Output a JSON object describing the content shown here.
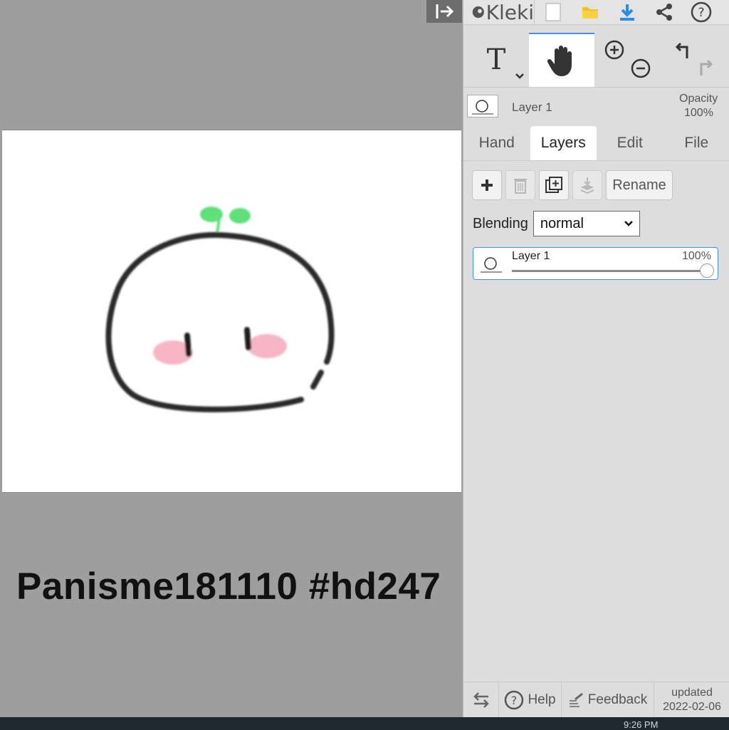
{
  "app": {
    "name": "Kleki"
  },
  "canvas": {
    "caption": "Panisme181110 #hd247"
  },
  "layer_info": {
    "name": "Layer 1",
    "opacity_label": "Opacity",
    "opacity_value": "100%"
  },
  "tabs": [
    {
      "label": "Hand",
      "active": false
    },
    {
      "label": "Layers",
      "active": true
    },
    {
      "label": "Edit",
      "active": false
    },
    {
      "label": "File",
      "active": false
    }
  ],
  "layers_panel": {
    "rename_label": "Rename",
    "blending_label": "Blending",
    "blending_value": "normal",
    "layers": [
      {
        "name": "Layer 1",
        "opacity": "100%",
        "opacity_level": 1.0
      }
    ]
  },
  "footer": {
    "help_label": "Help",
    "feedback_label": "Feedback",
    "updated_label": "updated",
    "updated_date": "2022-02-06"
  },
  "taskbar": {
    "clock": "9:26 PM"
  },
  "colors": {
    "accent": "#4a90e2",
    "folder": "#f2c21b",
    "download": "#2b8be8",
    "sprout": "#5fe07a",
    "blush": "#f7b6c6"
  }
}
